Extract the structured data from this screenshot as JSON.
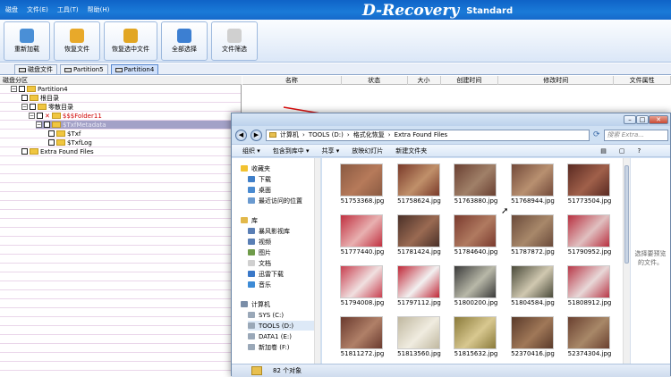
{
  "menu": [
    "磁盘",
    "文件(E)",
    "工具(T)",
    "帮助(H)"
  ],
  "brand": {
    "name": "D-Recovery",
    "edition": "Standard"
  },
  "toolbar": [
    {
      "label": "重新加载",
      "color": "#4a8fd6"
    },
    {
      "label": "恢复文件",
      "color": "#e8a92a"
    },
    {
      "label": "恢复选中文件",
      "color": "#e2a623"
    },
    {
      "label": "全部选择",
      "color": "#3c7fd2"
    },
    {
      "label": "文件筛选",
      "color": "#d0d0d0"
    }
  ],
  "tabs": [
    "磁盘文件",
    "Partition5",
    "Partition4"
  ],
  "left_header": "磁盘分区",
  "tree": [
    {
      "label": "Partition4",
      "red": false
    },
    {
      "label": "根目录",
      "red": false
    },
    {
      "label": "零散目录",
      "red": false
    },
    {
      "label": "$$$Folder11",
      "red": true
    },
    {
      "label": "$TxfMetadata",
      "red": false
    },
    {
      "label": "$Txf",
      "red": false
    },
    {
      "label": "$TxfLog",
      "red": false
    },
    {
      "label": "Extra Found Files",
      "red": false
    }
  ],
  "columns": [
    "名称",
    "状态",
    "大小",
    "创建时间",
    "修改时间",
    "文件属性"
  ],
  "explorer": {
    "breadcrumb": [
      "计算机",
      "TOOLS (D:)",
      "格式化恢复",
      "Extra Found Files"
    ],
    "search_placeholder": "搜索 Extra...",
    "commands": [
      "组织 ▾",
      "包含到库中 ▾",
      "共享 ▾",
      "放映幻灯片",
      "新建文件夹"
    ],
    "nav": [
      {
        "label": "收藏夹",
        "icon": "star-icon",
        "color": "#f2c230"
      },
      {
        "label": "下载",
        "icon": "download-folder-icon",
        "color": "#3f7fc9"
      },
      {
        "label": "桌面",
        "icon": "desktop-icon",
        "color": "#4a8bd1"
      },
      {
        "label": "最近访问的位置",
        "icon": "recent-places-icon",
        "color": "#6a9ad0"
      },
      {
        "label": "库",
        "icon": "library-icon",
        "color": "#e2b84a"
      },
      {
        "label": "暴风影视库",
        "icon": "video-library-icon",
        "color": "#5a7fb5"
      },
      {
        "label": "视频",
        "icon": "video-icon",
        "color": "#5a7fb5"
      },
      {
        "label": "图片",
        "icon": "pictures-icon",
        "color": "#6f9b4a"
      },
      {
        "label": "文档",
        "icon": "documents-icon",
        "color": "#d0d0d0"
      },
      {
        "label": "迅雷下载",
        "icon": "thunder-download-icon",
        "color": "#3a78c8"
      },
      {
        "label": "音乐",
        "icon": "music-icon",
        "color": "#3d8bd6"
      },
      {
        "label": "计算机",
        "icon": "computer-icon",
        "color": "#7a8ea8"
      },
      {
        "label": "SYS (C:)",
        "icon": "drive-icon",
        "color": "#9aa8b8"
      },
      {
        "label": "TOOLS (D:)",
        "icon": "drive-icon",
        "color": "#9aa8b8"
      },
      {
        "label": "DATA1 (E:)",
        "icon": "drive-icon",
        "color": "#9aa8b8"
      },
      {
        "label": "新加卷 (F:)",
        "icon": "drive-icon",
        "color": "#9aa8b8"
      }
    ],
    "files": [
      {
        "name": "51753368.jpg",
        "c1": "#8a5a42",
        "c2": "#b67a5a"
      },
      {
        "name": "51758624.jpg",
        "c1": "#7a3a2a",
        "c2": "#c0906a"
      },
      {
        "name": "51763880.jpg",
        "c1": "#6a4032",
        "c2": "#a08068"
      },
      {
        "name": "51768944.jpg",
        "c1": "#734a3a",
        "c2": "#b89070"
      },
      {
        "name": "51773504.jpg",
        "c1": "#5a2a22",
        "c2": "#a0604a"
      },
      {
        "name": "51777440.jpg",
        "c1": "#c03040",
        "c2": "#e8b0b0"
      },
      {
        "name": "51781424.jpg",
        "c1": "#4a3028",
        "c2": "#9a6a52"
      },
      {
        "name": "51784640.jpg",
        "c1": "#7a3a2e",
        "c2": "#b07a60"
      },
      {
        "name": "51787872.jpg",
        "c1": "#6a4a3a",
        "c2": "#a8886a"
      },
      {
        "name": "51790952.jpg",
        "c1": "#b83040",
        "c2": "#e0c0c0"
      },
      {
        "name": "51794008.jpg",
        "c1": "#c84050",
        "c2": "#f0e0e0"
      },
      {
        "name": "51797112.jpg",
        "c1": "#c02838",
        "c2": "#f2f0f0"
      },
      {
        "name": "51800200.jpg",
        "c1": "#3a3a3a",
        "c2": "#b8b8a8"
      },
      {
        "name": "51804584.jpg",
        "c1": "#4a4a3a",
        "c2": "#d0c8b0"
      },
      {
        "name": "51808912.jpg",
        "c1": "#b83848",
        "c2": "#e8d8d8"
      },
      {
        "name": "51811272.jpg",
        "c1": "#6a3a2e",
        "c2": "#b08068"
      },
      {
        "name": "51813560.jpg",
        "c1": "#c0b8a0",
        "c2": "#f0ece0"
      },
      {
        "name": "51815632.jpg",
        "c1": "#8a7a3a",
        "c2": "#d8c890"
      },
      {
        "name": "52370416.jpg",
        "c1": "#5a3a2a",
        "c2": "#a07858"
      },
      {
        "name": "52374304.jpg",
        "c1": "#6a4030",
        "c2": "#a88868"
      }
    ],
    "preview_text": "选择要预览的文件。",
    "item_count": "82 个对象"
  }
}
